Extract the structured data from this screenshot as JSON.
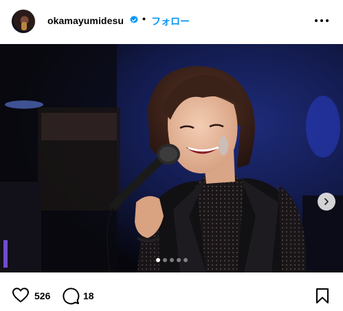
{
  "header": {
    "username": "okamayumidesu",
    "separator": "•",
    "follow_label": "フォロー",
    "verified_icon": "verified-badge-icon",
    "more_icon": "more-horizontal-icon"
  },
  "carousel": {
    "total_slides": 5,
    "current_slide": 1,
    "next_icon": "chevron-right-icon"
  },
  "actions": {
    "like_count": "526",
    "comment_count": "18",
    "like_icon": "heart-icon",
    "comment_icon": "comment-bubble-icon",
    "save_icon": "bookmark-icon"
  },
  "colors": {
    "link_blue": "#0095f6",
    "verified_blue": "#0095f6",
    "text": "#000000"
  }
}
